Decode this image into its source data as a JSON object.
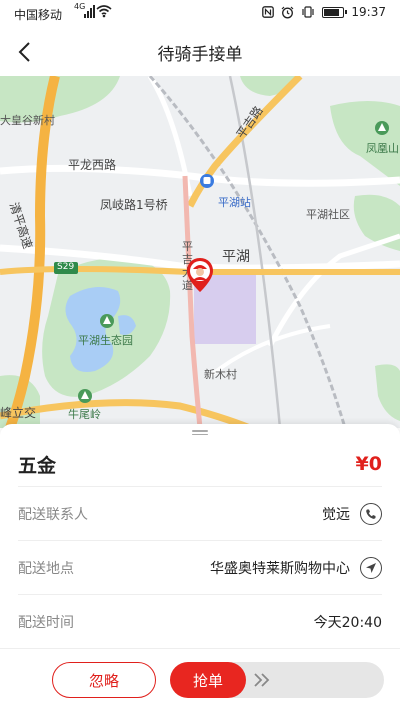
{
  "status_bar": {
    "carrier": "中国移动",
    "network": "4G",
    "time": "19:37"
  },
  "header": {
    "title": "待骑手接单",
    "back_icon": "chevron-left-icon"
  },
  "map": {
    "labels": {
      "huangguxin": "大皇谷新村",
      "pinglong_west_road": "平龙西路",
      "qingping_expressway": "清平高速",
      "fengqi_road_bridge": "凤岐路1号桥",
      "pinghu_station": "平湖站",
      "pingji_road": "平吉路",
      "pinghu_community": "平湖社区",
      "pinghu": "平湖",
      "s29": "S29",
      "pinghu_park": "平湖生态园",
      "xinmu_village": "新木村",
      "niuweiling": "牛尾岭",
      "fengli_interchange": "峰立交",
      "fenghuangshan": "凤凰山",
      "ping_road_vertical": "平吉大道"
    },
    "rider_marker_icon": "rider-avatar-icon"
  },
  "order": {
    "goods": "五金",
    "price": "¥0",
    "rows": [
      {
        "label": "配送联系人",
        "value": "觉远",
        "icon": "phone-icon"
      },
      {
        "label": "配送地点",
        "value": "华盛奥特莱斯购物中心",
        "icon": "navigate-icon"
      },
      {
        "label": "配送时间",
        "value": "今天20:40"
      }
    ]
  },
  "actions": {
    "ignore_label": "忽略",
    "grab_label": "抢单",
    "slider_arrows_icon": "double-chevron-right-icon"
  },
  "colors": {
    "accent": "#e0201c",
    "map_road_major": "#f5b342",
    "map_green": "#c7e6c4",
    "map_water": "#a9cdf5"
  }
}
